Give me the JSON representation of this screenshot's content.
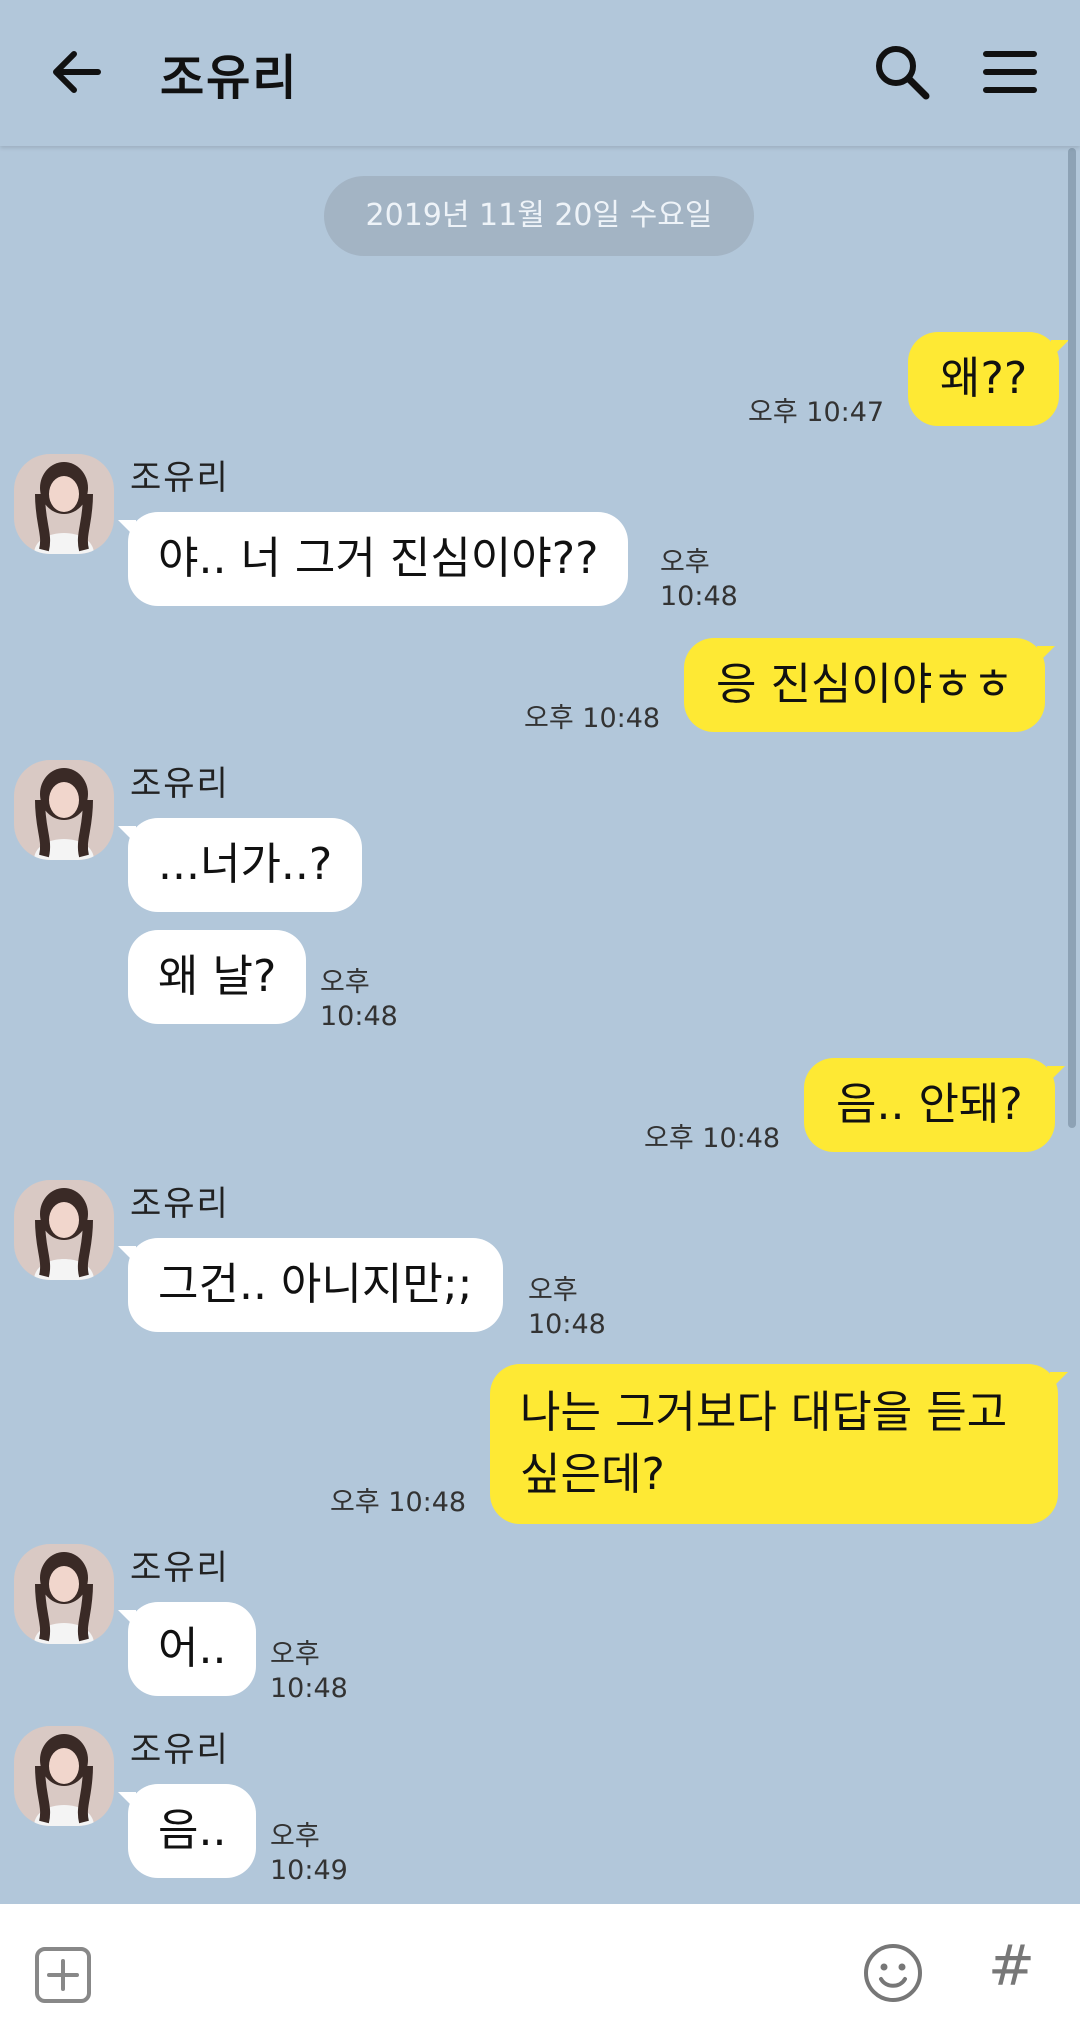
{
  "header": {
    "title": "조유리"
  },
  "date_divider": "2019년 11월 20일 수요일",
  "messages": [
    {
      "text": "왜??",
      "time": "오후 10:47"
    },
    {
      "sender": "조유리",
      "text": "야.. 너 그거 진심이야??",
      "time": "오후 10:48"
    },
    {
      "text": "응 진심이야ㅎㅎ",
      "time": "오후 10:48"
    },
    {
      "sender": "조유리",
      "text": "...너가..?"
    },
    {
      "text": "왜 날?",
      "time": "오후 10:48"
    },
    {
      "text": "음.. 안돼?",
      "time": "오후 10:48"
    },
    {
      "sender": "조유리",
      "text": "그건.. 아니지만;;",
      "time": "오후 10:48"
    },
    {
      "text": "나는 그거보다 대답을 듣고 싶은데?",
      "time": "오후 10:48"
    },
    {
      "sender": "조유리",
      "text": "어..",
      "time": "오후 10:48"
    },
    {
      "sender": "조유리",
      "text": "음..",
      "time": "오후 10:49"
    }
  ],
  "colors": {
    "background": "#b2c7da",
    "my_bubble": "#fee934",
    "their_bubble": "#ffffff"
  },
  "icons": [
    "back-arrow-icon",
    "search-icon",
    "menu-icon",
    "plus-icon",
    "emoji-icon",
    "hash-icon"
  ],
  "bottom_bar": {
    "hash_label": "#"
  }
}
